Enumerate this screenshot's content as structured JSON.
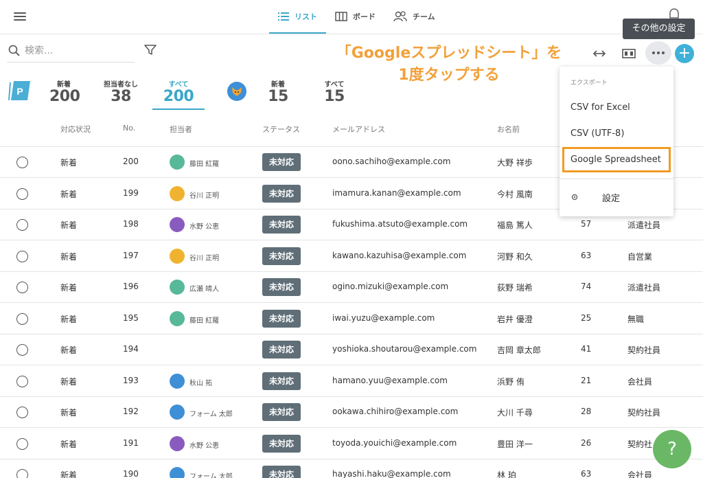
{
  "header": {
    "tabs": [
      {
        "label": "リスト",
        "icon": "list-icon",
        "active": true
      },
      {
        "label": "ボード",
        "icon": "board-icon",
        "active": false
      },
      {
        "label": "チーム",
        "icon": "team-icon",
        "active": false
      }
    ]
  },
  "tooltip": "その他の設定",
  "search": {
    "placeholder": "検索..."
  },
  "annotation": {
    "line1": "「Googleスプレッドシート」を",
    "line2": "1度タップする"
  },
  "toolbar": {
    "add_label": "+"
  },
  "stats": {
    "group1": [
      {
        "label": "新着",
        "value": "200"
      },
      {
        "label": "担当者なし",
        "value": "38"
      },
      {
        "label": "すべて",
        "value": "200",
        "active": true
      }
    ],
    "group2": [
      {
        "label": "新着",
        "value": "15"
      },
      {
        "label": "すべて",
        "value": "15"
      }
    ],
    "logo_letter": "P"
  },
  "table": {
    "headers": [
      "対応状況",
      "No.",
      "担当者",
      "ステータス",
      "メールアドレス",
      "お名前"
    ],
    "rows": [
      {
        "status": "新着",
        "no": "200",
        "owner": "藤田 紅羅",
        "ava": "#57b89a",
        "badge": "未対応",
        "email": "oono.sachiho@example.com",
        "name": "大野 祥歩",
        "age": "",
        "job": ""
      },
      {
        "status": "新着",
        "no": "199",
        "owner": "谷川 正明",
        "ava": "#f0b330",
        "badge": "未対応",
        "email": "imamura.kanan@example.com",
        "name": "今村 風南",
        "age": "",
        "job": ""
      },
      {
        "status": "新着",
        "no": "198",
        "owner": "水野 公恵",
        "ava": "#8a5bbf",
        "badge": "未対応",
        "email": "fukushima.atsuto@example.com",
        "name": "福島 篤人",
        "age": "57",
        "job": "派遣社員"
      },
      {
        "status": "新着",
        "no": "197",
        "owner": "谷川 正明",
        "ava": "#f0b330",
        "badge": "未対応",
        "email": "kawano.kazuhisa@example.com",
        "name": "河野 和久",
        "age": "63",
        "job": "自営業"
      },
      {
        "status": "新着",
        "no": "196",
        "owner": "広瀬 晴人",
        "ava": "#57b89a",
        "badge": "未対応",
        "email": "ogino.mizuki@example.com",
        "name": "荻野 瑞希",
        "age": "74",
        "job": "派遣社員"
      },
      {
        "status": "新着",
        "no": "195",
        "owner": "藤田 紅羅",
        "ava": "#57b89a",
        "badge": "未対応",
        "email": "iwai.yuzu@example.com",
        "name": "岩井 優澄",
        "age": "25",
        "job": "無職"
      },
      {
        "status": "新着",
        "no": "194",
        "owner": "",
        "ava": "",
        "badge": "未対応",
        "email": "yoshioka.shoutarou@example.com",
        "name": "吉岡 章太郎",
        "age": "41",
        "job": "契約社員"
      },
      {
        "status": "新着",
        "no": "193",
        "owner": "秋山 拓",
        "ava": "#3e8fd6",
        "badge": "未対応",
        "email": "hamano.yuu@example.com",
        "name": "浜野 侑",
        "age": "21",
        "job": "会社員"
      },
      {
        "status": "新着",
        "no": "192",
        "owner": "フォーム 太郎",
        "ava": "#3e8fd6",
        "badge": "未対応",
        "email": "ookawa.chihiro@example.com",
        "name": "大川 千尋",
        "age": "28",
        "job": "契約社員"
      },
      {
        "status": "新着",
        "no": "191",
        "owner": "水野 公恵",
        "ava": "#8a5bbf",
        "badge": "未対応",
        "email": "toyoda.youichi@example.com",
        "name": "豊田 洋一",
        "age": "26",
        "job": "契約社"
      },
      {
        "status": "新着",
        "no": "190",
        "owner": "フォーム 太郎",
        "ava": "#3e8fd6",
        "badge": "未対応",
        "email": "hayashi.haku@example.com",
        "name": "林 珀",
        "age": "63",
        "job": "会社員"
      }
    ]
  },
  "dropdown": {
    "header": "エクスポート",
    "items": [
      "CSV for Excel",
      "CSV (UTF-8)",
      "Google Spreadsheet"
    ],
    "settings": "設定"
  },
  "help": "?",
  "colors": {
    "accent": "#39a7c8",
    "highlight": "#f29b23",
    "annotation": "#f2a13a",
    "badge": "#5f6e77",
    "help": "#6ab866"
  }
}
